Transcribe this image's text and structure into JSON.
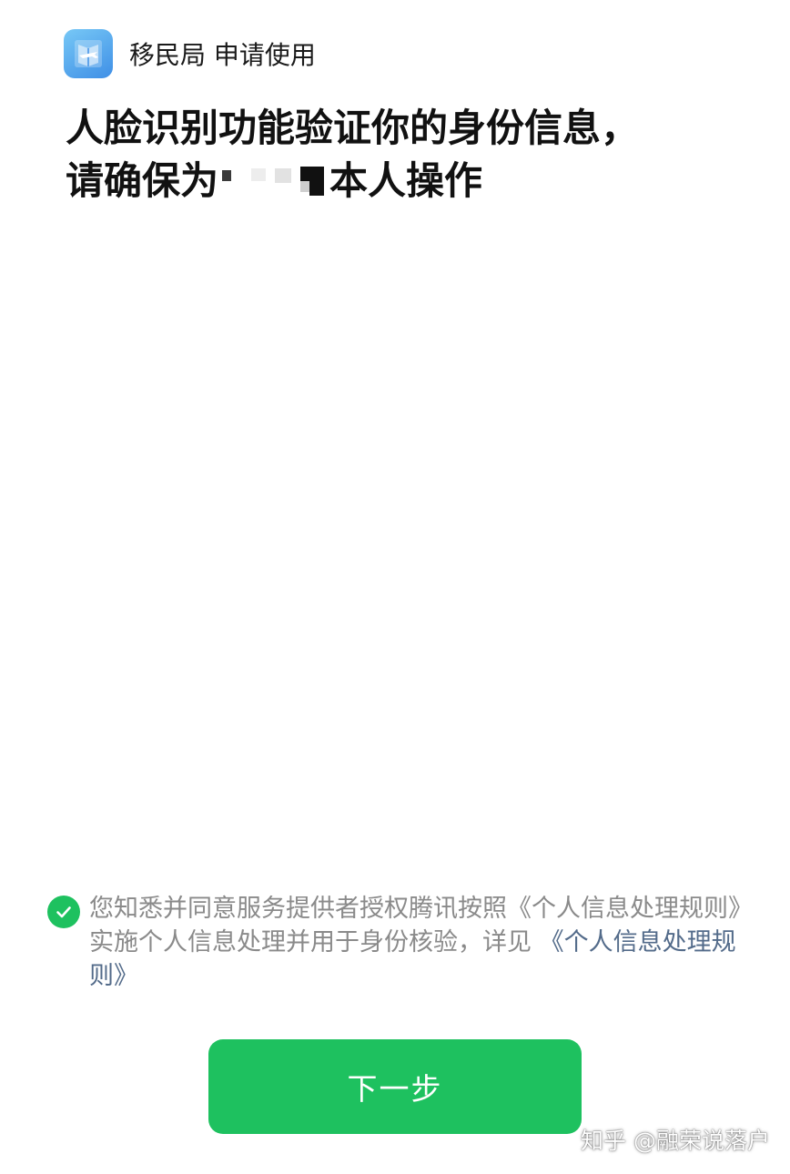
{
  "header": {
    "requester": "移民局 申请使用",
    "icon": "immigration-app-icon"
  },
  "title": {
    "line1": "人脸识别功能验证你的身份信息，",
    "line2_prefix": "请确保为",
    "line2_suffix": "本人操作"
  },
  "consent": {
    "checked": true,
    "text": "您知悉并同意服务提供者授权腾讯按照《个人信息处理规则》实施个人信息处理并用于身份核验，详见",
    "link": "《个人信息处理规则》"
  },
  "next_button": {
    "label": "下一步"
  },
  "watermark": "知乎 @融荣说落户",
  "colors": {
    "accent_green": "#1ec15f",
    "link_blue": "#536b8a",
    "muted_text": "#8a8a8a",
    "icon_blue": "#3f8fe6"
  }
}
